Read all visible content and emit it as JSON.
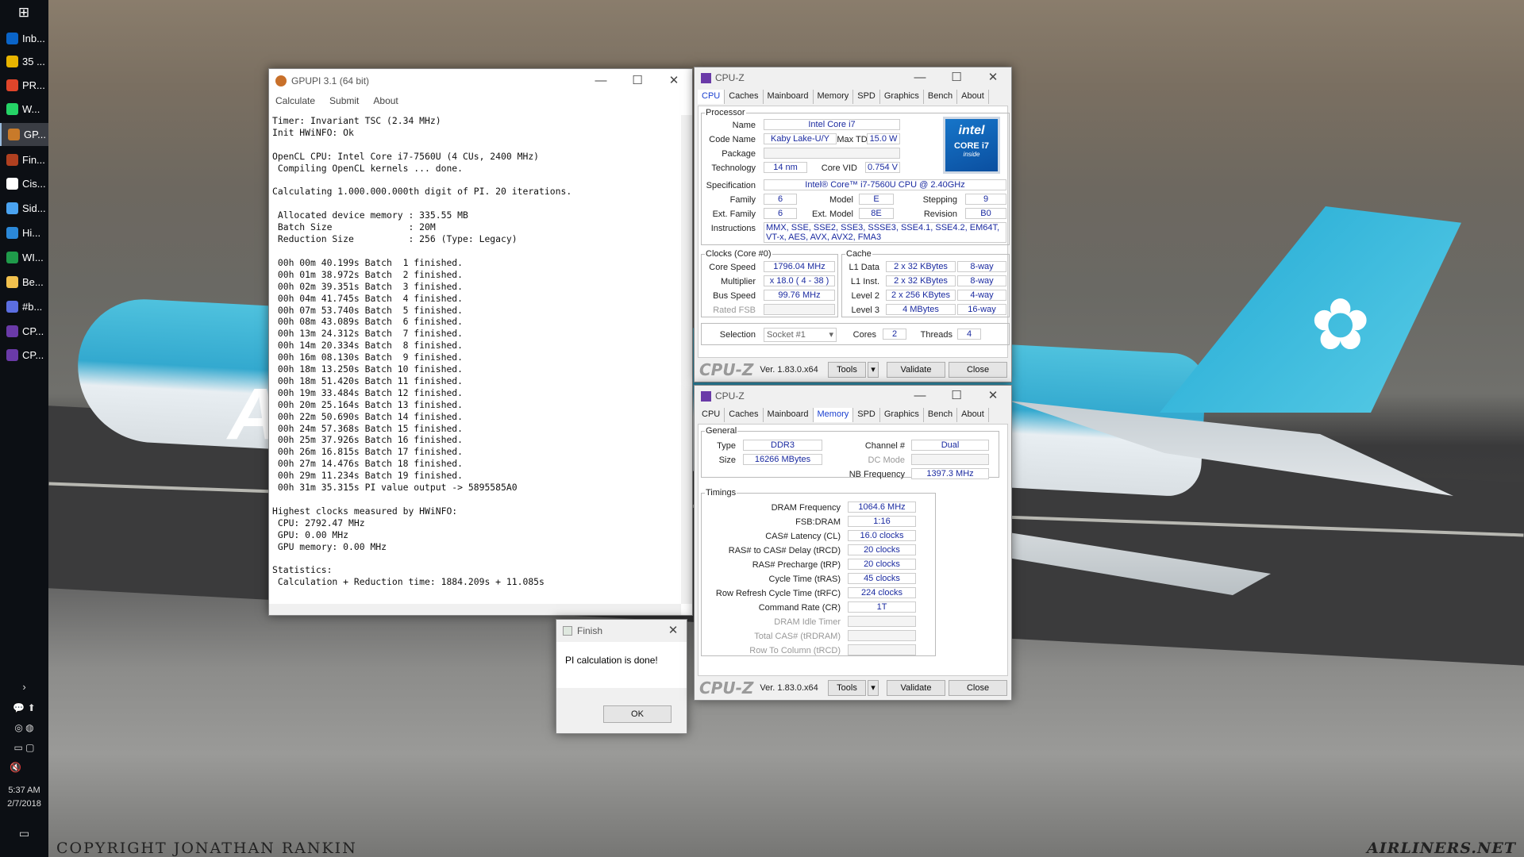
{
  "taskbar": {
    "start_icon": "windows-logo",
    "items": [
      {
        "label": "Inb...",
        "color": "#0a64c8"
      },
      {
        "label": "35 ...",
        "color": "#e8b400"
      },
      {
        "label": "PR...",
        "color": "#e0452a"
      },
      {
        "label": "W...",
        "color": "#25d366"
      },
      {
        "label": "GP...",
        "color": "#c87a2a"
      },
      {
        "label": "Fin...",
        "color": "#b04020"
      },
      {
        "label": "Cis...",
        "color": "#ffffff"
      },
      {
        "label": "Sid...",
        "color": "#4aa3f0"
      },
      {
        "label": "Hi...",
        "color": "#2b88d8"
      },
      {
        "label": "WI...",
        "color": "#1f9a4a"
      },
      {
        "label": "Be...",
        "color": "#f2c14e"
      },
      {
        "label": "#b...",
        "color": "#5b6ee1"
      },
      {
        "label": "CP...",
        "color": "#6a3aa8"
      },
      {
        "label": "CP...",
        "color": "#6a3aa8"
      }
    ],
    "clock_time": "5:37 AM",
    "clock_date": "2/7/2018"
  },
  "wallpaper": {
    "copyright": "COPYRIGHT JONATHAN RANKIN",
    "site": "AIRLINERS.NET",
    "livery_text": "Air"
  },
  "gpupi": {
    "title": "GPUPI 3.1 (64 bit)",
    "menu": [
      "Calculate",
      "Submit",
      "About"
    ],
    "console": "Timer: Invariant TSC (2.34 MHz)\nInit HWiNFO: Ok\n\nOpenCL CPU: Intel Core i7-7560U (4 CUs, 2400 MHz)\n Compiling OpenCL kernels ... done.\n\nCalculating 1.000.000.000th digit of PI. 20 iterations.\n\n Allocated device memory : 335.55 MB\n Batch Size              : 20M\n Reduction Size          : 256 (Type: Legacy)\n\n 00h 00m 40.199s Batch  1 finished.\n 00h 01m 38.972s Batch  2 finished.\n 00h 02m 39.351s Batch  3 finished.\n 00h 04m 41.745s Batch  4 finished.\n 00h 07m 53.740s Batch  5 finished.\n 00h 08m 43.089s Batch  6 finished.\n 00h 13m 24.312s Batch  7 finished.\n 00h 14m 20.334s Batch  8 finished.\n 00h 16m 08.130s Batch  9 finished.\n 00h 18m 13.250s Batch 10 finished.\n 00h 18m 51.420s Batch 11 finished.\n 00h 19m 33.484s Batch 12 finished.\n 00h 20m 25.164s Batch 13 finished.\n 00h 22m 50.690s Batch 14 finished.\n 00h 24m 57.368s Batch 15 finished.\n 00h 25m 37.926s Batch 16 finished.\n 00h 26m 16.815s Batch 17 finished.\n 00h 27m 14.476s Batch 18 finished.\n 00h 29m 11.234s Batch 19 finished.\n 00h 31m 35.315s PI value output -> 5895585A0\n\nHighest clocks measured by HWiNFO:\n CPU: 2792.47 MHz\n GPU: 0.00 MHz\n GPU memory: 0.00 MHz\n\nStatistics:\n Calculation + Reduction time: 1884.209s + 11.085s"
  },
  "finish": {
    "title": "Finish",
    "message": "PI calculation is done!",
    "ok": "OK"
  },
  "cpuz_tabs": [
    "CPU",
    "Caches",
    "Mainboard",
    "Memory",
    "SPD",
    "Graphics",
    "Bench",
    "About"
  ],
  "cpuz_cpu": {
    "title": "CPU-Z",
    "processor_legend": "Processor",
    "name_label": "Name",
    "name": "Intel Core i7",
    "codename_label": "Code Name",
    "codename": "Kaby Lake-U/Y",
    "maxtdp_label": "Max TDP",
    "maxtdp": "15.0 W",
    "package_label": "Package",
    "technology_label": "Technology",
    "technology": "14 nm",
    "corevid_label": "Core VID",
    "corevid": "0.754 V",
    "spec_label": "Specification",
    "spec": "Intel® Core™ i7-7560U CPU @ 2.40GHz",
    "family_label": "Family",
    "family": "6",
    "model_label": "Model",
    "model": "E",
    "stepping_label": "Stepping",
    "stepping": "9",
    "extfamily_label": "Ext. Family",
    "extfamily": "6",
    "extmodel_label": "Ext. Model",
    "extmodel": "8E",
    "revision_label": "Revision",
    "revision": "B0",
    "instructions_label": "Instructions",
    "instructions": "MMX, SSE, SSE2, SSE3, SSSE3, SSE4.1, SSE4.2, EM64T, VT-x, AES, AVX, AVX2, FMA3",
    "intel_logo": {
      "brand": "intel",
      "line1": "CORE i7",
      "line2": "inside"
    },
    "clocks_legend": "Clocks (Core #0)",
    "corespeed_label": "Core Speed",
    "corespeed": "1796.04 MHz",
    "multiplier_label": "Multiplier",
    "multiplier": "x 18.0 ( 4 - 38 )",
    "busspeed_label": "Bus Speed",
    "busspeed": "99.76 MHz",
    "ratedfsb_label": "Rated FSB",
    "cache_legend": "Cache",
    "l1data_label": "L1 Data",
    "l1data": "2 x 32 KBytes",
    "l1data_way": "8-way",
    "l1inst_label": "L1 Inst.",
    "l1inst": "2 x 32 KBytes",
    "l1inst_way": "8-way",
    "l2_label": "Level 2",
    "l2": "2 x 256 KBytes",
    "l2_way": "4-way",
    "l3_label": "Level 3",
    "l3": "4 MBytes",
    "l3_way": "16-way",
    "selection_label": "Selection",
    "selection": "Socket #1",
    "cores_label": "Cores",
    "cores": "2",
    "threads_label": "Threads",
    "threads": "4",
    "brand": "CPU-Z",
    "version": "Ver. 1.83.0.x64",
    "tools": "Tools",
    "validate": "Validate",
    "close": "Close"
  },
  "cpuz_mem": {
    "title": "CPU-Z",
    "general_legend": "General",
    "type_label": "Type",
    "type": "DDR3",
    "size_label": "Size",
    "size": "16266 MBytes",
    "channel_label": "Channel #",
    "channel": "Dual",
    "dcmode_label": "DC Mode",
    "nbfreq_label": "NB Frequency",
    "nbfreq": "1397.3 MHz",
    "timings_legend": "Timings",
    "timings": [
      {
        "label": "DRAM Frequency",
        "value": "1064.6 MHz",
        "dim": false
      },
      {
        "label": "FSB:DRAM",
        "value": "1:16",
        "dim": false
      },
      {
        "label": "CAS# Latency (CL)",
        "value": "16.0 clocks",
        "dim": false
      },
      {
        "label": "RAS# to CAS# Delay (tRCD)",
        "value": "20 clocks",
        "dim": false
      },
      {
        "label": "RAS# Precharge (tRP)",
        "value": "20 clocks",
        "dim": false
      },
      {
        "label": "Cycle Time (tRAS)",
        "value": "45 clocks",
        "dim": false
      },
      {
        "label": "Row Refresh Cycle Time (tRFC)",
        "value": "224 clocks",
        "dim": false
      },
      {
        "label": "Command Rate (CR)",
        "value": "1T",
        "dim": false
      },
      {
        "label": "DRAM Idle Timer",
        "value": "",
        "dim": true
      },
      {
        "label": "Total CAS# (tRDRAM)",
        "value": "",
        "dim": true
      },
      {
        "label": "Row To Column (tRCD)",
        "value": "",
        "dim": true
      }
    ],
    "brand": "CPU-Z",
    "version": "Ver. 1.83.0.x64",
    "tools": "Tools",
    "validate": "Validate",
    "close": "Close"
  }
}
